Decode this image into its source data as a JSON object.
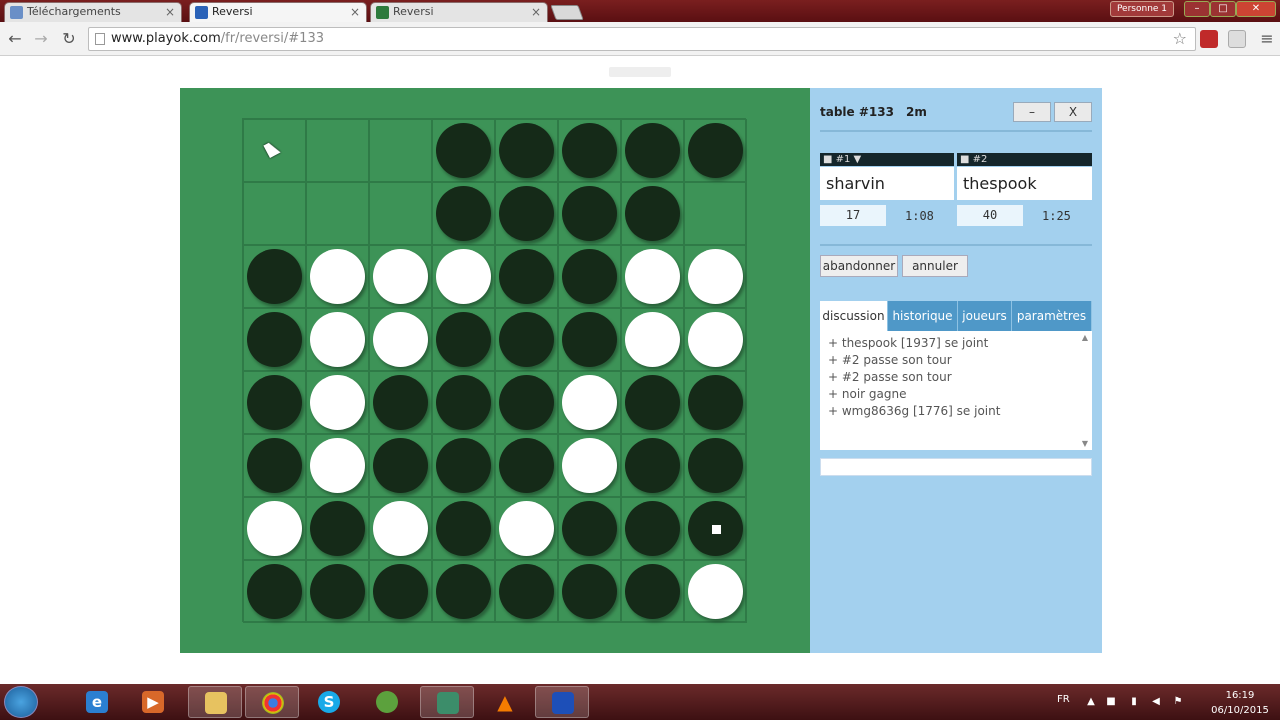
{
  "browser": {
    "tabs": [
      {
        "label": "Téléchargements",
        "active": false,
        "favicon_color": "#6a8fc7"
      },
      {
        "label": "Reversi",
        "active": true,
        "favicon_color": "#2a62b8"
      },
      {
        "label": "Reversi",
        "active": false,
        "favicon_color": "#2c7a3c"
      }
    ],
    "close_glyph": "×",
    "user_label": "Personne 1",
    "url_domain": "www.playok.com",
    "url_path": "/fr/reversi/#133",
    "back_glyph": "←",
    "forward_glyph": "→",
    "reload_glyph": "↻",
    "star_glyph": "☆",
    "window_min": "–",
    "window_max": "□",
    "window_close": "✕"
  },
  "game": {
    "table_label": "table #133",
    "time_label": "2m",
    "minimize_label": "–",
    "close_label": "X",
    "players": [
      {
        "header": "■ #1 ▼",
        "name": "sharvin",
        "score": "17",
        "clock": "1:08"
      },
      {
        "header": "■ #2",
        "name": "thespook",
        "score": "40",
        "clock": "1:25"
      }
    ],
    "actions": {
      "resign": "abandonner",
      "cancel": "annuler"
    },
    "tabs": [
      "discussion",
      "historique",
      "joueurs",
      "paramètres"
    ],
    "active_tab": "discussion",
    "chat": [
      "+ thespook [1937] se joint",
      "+ #2 passe son tour",
      "+ #2 passe son tour",
      "+ noir gagne",
      "+ wmg8636g [1776] se joint"
    ],
    "board": [
      "...BBBBB",
      "...BBBB.",
      "BWWWBBWW",
      "BWWBBBWW",
      "BWBBBWBB",
      "BWBBBWBB",
      "WBWBWBBB",
      "BBBBBBBW"
    ],
    "last_move": {
      "row": 6,
      "col": 7
    },
    "colors": {
      "board": "#3d9357",
      "panel": "#a3d0ee",
      "black": "#152a18",
      "white": "#ffffff"
    }
  },
  "taskbar": {
    "items": [
      "ie-icon",
      "media-icon",
      "explorer-icon",
      "chrome-icon",
      "skype-icon",
      "xbox-icon",
      "app-icon",
      "vlc-icon",
      "remote-icon"
    ],
    "language": "FR",
    "time": "16:19",
    "date": "06/10/2015"
  }
}
